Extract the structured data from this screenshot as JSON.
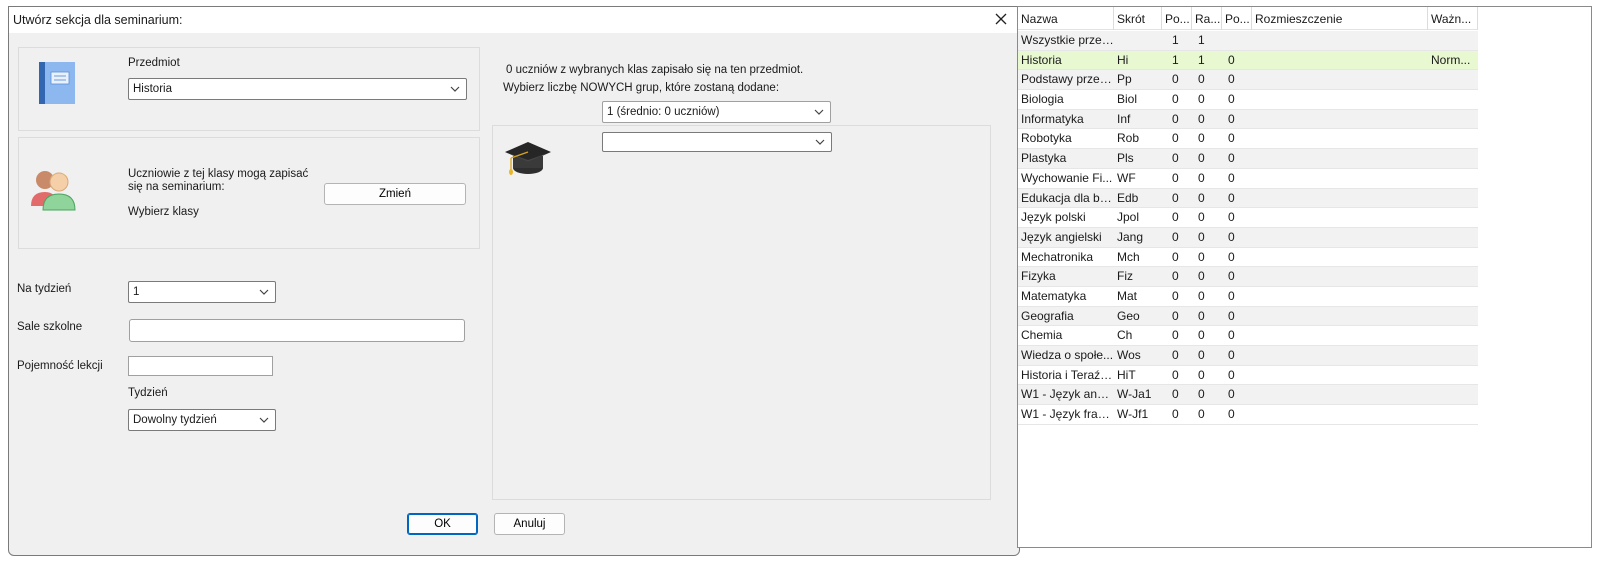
{
  "dialog": {
    "title": "Utwórz sekcja dla seminarium:",
    "subject_label": "Przedmiot",
    "subject_value": "Historia",
    "classes_info": "Uczniowie z tej klasy mogą zapisać się na seminarium:",
    "change_button": "Zmień",
    "choose_classes": "Wybierz klasy",
    "per_week_label": "Na tydzień",
    "per_week_value": "1",
    "rooms_label": "Sale szkolne",
    "rooms_value": "",
    "capacity_label": "Pojemność lekcji",
    "capacity_value": "",
    "week_label": "Tydzień",
    "week_value": "Dowolny tydzień",
    "enrolled_info": "0 uczniów z wybranych klas zapisało się na ten przedmiot.",
    "new_groups_prompt": "Wybierz liczbę NOWYCH grup, które zostaną dodane:",
    "groups_value": "1 (średnio: 0 uczniów)",
    "group_combo_value": "",
    "ok_button": "OK",
    "cancel_button": "Anuluj"
  },
  "table": {
    "columns": [
      "Nazwa",
      "Skrót",
      "Po...",
      "Ra...",
      "Po...",
      "Rozmieszczenie",
      "Ważn..."
    ],
    "rows": [
      {
        "name": "Wszystkie przed...",
        "abbr": "",
        "c1": "1",
        "c2": "1",
        "c3": "",
        "place": "",
        "weight": ""
      },
      {
        "name": "Historia",
        "abbr": "Hi",
        "c1": "1",
        "c2": "1",
        "c3": "0",
        "place": "",
        "weight": "Norm..."
      },
      {
        "name": "Podstawy przed...",
        "abbr": "Pp",
        "c1": "0",
        "c2": "0",
        "c3": "0",
        "place": "",
        "weight": ""
      },
      {
        "name": "Biologia",
        "abbr": "Biol",
        "c1": "0",
        "c2": "0",
        "c3": "0",
        "place": "",
        "weight": ""
      },
      {
        "name": "Informatyka",
        "abbr": "Inf",
        "c1": "0",
        "c2": "0",
        "c3": "0",
        "place": "",
        "weight": ""
      },
      {
        "name": "Robotyka",
        "abbr": "Rob",
        "c1": "0",
        "c2": "0",
        "c3": "0",
        "place": "",
        "weight": ""
      },
      {
        "name": "Plastyka",
        "abbr": "Pls",
        "c1": "0",
        "c2": "0",
        "c3": "0",
        "place": "",
        "weight": ""
      },
      {
        "name": "Wychowanie Fi...",
        "abbr": "WF",
        "c1": "0",
        "c2": "0",
        "c3": "0",
        "place": "",
        "weight": ""
      },
      {
        "name": "Edukacja dla be...",
        "abbr": "Edb",
        "c1": "0",
        "c2": "0",
        "c3": "0",
        "place": "",
        "weight": ""
      },
      {
        "name": "Język polski",
        "abbr": "Jpol",
        "c1": "0",
        "c2": "0",
        "c3": "0",
        "place": "",
        "weight": ""
      },
      {
        "name": "Język angielski",
        "abbr": "Jang",
        "c1": "0",
        "c2": "0",
        "c3": "0",
        "place": "",
        "weight": ""
      },
      {
        "name": "Mechatronika",
        "abbr": "Mch",
        "c1": "0",
        "c2": "0",
        "c3": "0",
        "place": "",
        "weight": ""
      },
      {
        "name": "Fizyka",
        "abbr": "Fiz",
        "c1": "0",
        "c2": "0",
        "c3": "0",
        "place": "",
        "weight": ""
      },
      {
        "name": "Matematyka",
        "abbr": "Mat",
        "c1": "0",
        "c2": "0",
        "c3": "0",
        "place": "",
        "weight": ""
      },
      {
        "name": "Geografia",
        "abbr": "Geo",
        "c1": "0",
        "c2": "0",
        "c3": "0",
        "place": "",
        "weight": ""
      },
      {
        "name": "Chemia",
        "abbr": "Ch",
        "c1": "0",
        "c2": "0",
        "c3": "0",
        "place": "",
        "weight": ""
      },
      {
        "name": "Wiedza o społe...",
        "abbr": "Wos",
        "c1": "0",
        "c2": "0",
        "c3": "0",
        "place": "",
        "weight": ""
      },
      {
        "name": "Historia i Teraźn...",
        "abbr": "HiT",
        "c1": "0",
        "c2": "0",
        "c3": "0",
        "place": "",
        "weight": ""
      },
      {
        "name": "W1 - Język angi...",
        "abbr": "W-Ja1",
        "c1": "0",
        "c2": "0",
        "c3": "0",
        "place": "",
        "weight": ""
      },
      {
        "name": "W1 - Język fran...",
        "abbr": "W-Jf1",
        "c1": "0",
        "c2": "0",
        "c3": "0",
        "place": "",
        "weight": ""
      }
    ],
    "selected_index": 1
  },
  "colors": {
    "selected_row": "#e8f8d0",
    "alt_row": "#f2f2f2",
    "primary_border": "#0067c0"
  }
}
